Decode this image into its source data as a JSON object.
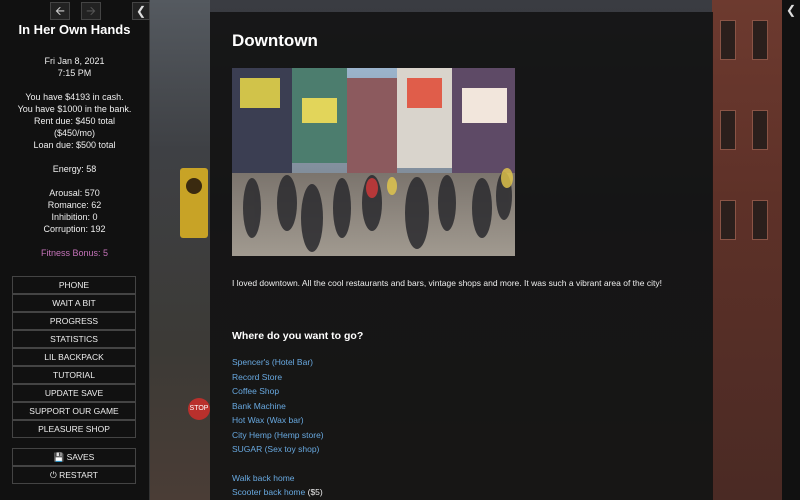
{
  "sidebar": {
    "title": "In Her Own Hands",
    "nav_back_icon": "arrow-left-icon",
    "nav_forward_icon": "arrow-right-icon",
    "collapse_icon": "chevron-left-icon",
    "date": "Fri Jan 8, 2021",
    "time": "7:15 PM",
    "cash": "You have $4193 in cash.",
    "bank": "You have $1000 in the bank.",
    "rent_line1": "Rent due: $450 total",
    "rent_line2": "($450/mo)",
    "loan": "Loan due: $500 total",
    "energy": "Energy: 58",
    "arousal": "Arousal: 570",
    "romance": "Romance: 62",
    "inhibition": "Inhibition: 0",
    "corruption": "Corruption: 192",
    "fitness": "Fitness Bonus: 5",
    "fitness_color": "#c573b9",
    "menu": [
      "PHONE",
      "WAIT A BIT",
      "PROGRESS",
      "STATISTICS",
      "LIL BACKPACK",
      "TUTORIAL",
      "UPDATE SAVE",
      "SUPPORT OUR GAME",
      "PLEASURE SHOP"
    ],
    "saves_label": "SAVES",
    "saves_icon": "floppy-disk-icon",
    "restart_label": "RESTART",
    "restart_icon": "power-icon"
  },
  "right_collapse_icon": "chevron-left-icon",
  "passage": {
    "title": "Downtown",
    "image_alt": "blurred crowd on a busy downtown street",
    "text": "I loved downtown. All the cool restaurants and bars, vintage shops and more. It was such a vibrant area of the city!",
    "question": "Where do you want to go?",
    "links": [
      "Spencer's (Hotel Bar)",
      "Record Store",
      "Coffee Shop",
      "Bank Machine",
      "Hot Wax (Wax bar)",
      "City Hemp (Hemp store)",
      "SUGAR (Sex toy shop)"
    ],
    "walk_home": "Walk back home",
    "scooter_home": "Scooter back home",
    "scooter_price": "($5)",
    "link_color": "#68a9e0"
  }
}
